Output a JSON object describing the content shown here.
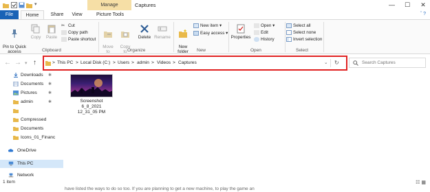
{
  "titlebar": {
    "manage_label": "Manage",
    "window_title": "Captures",
    "min": "—",
    "max": "☐",
    "close": "✕"
  },
  "tabs": {
    "file": "File",
    "home": "Home",
    "share": "Share",
    "view": "View",
    "picture_tools": "Picture Tools"
  },
  "ribbon": {
    "pin_to_quick_access": "Pin to Quick\naccess",
    "copy": "Copy",
    "paste": "Paste",
    "cut": "Cut",
    "copy_path": "Copy path",
    "paste_shortcut": "Paste shortcut",
    "move_to": "Move\nto",
    "copy_to": "Copy\nto",
    "delete": "Delete",
    "rename": "Rename",
    "new_folder": "New\nfolder",
    "new_item": "New item",
    "easy_access": "Easy access",
    "properties": "Properties",
    "open": "Open",
    "edit": "Edit",
    "history": "History",
    "select_all": "Select all",
    "select_none": "Select none",
    "invert_selection": "Invert selection",
    "group_clipboard": "Clipboard",
    "group_organize": "Organize",
    "group_new": "New",
    "group_open": "Open",
    "group_select": "Select"
  },
  "address": {
    "crumbs": [
      "This PC",
      "Local Disk (C:)",
      "Users",
      "admin",
      "Videos",
      "Captures"
    ],
    "separator": ">",
    "search_placeholder": "Search Captures"
  },
  "navpane": {
    "items": [
      {
        "label": "Downloads",
        "icon": "download-icon",
        "pinned": true
      },
      {
        "label": "Documents",
        "icon": "documents-icon",
        "pinned": true
      },
      {
        "label": "Pictures",
        "icon": "pictures-icon",
        "pinned": true
      },
      {
        "label": "admin",
        "icon": "folder-icon",
        "pinned": true
      },
      {
        "label": "Compressed",
        "icon": "folder-icon",
        "pinned": false
      },
      {
        "label": "Documents",
        "icon": "folder-icon",
        "pinned": false
      },
      {
        "label": "Icons_01_Financ",
        "icon": "folder-icon",
        "pinned": false
      },
      {
        "label": "OneDrive",
        "icon": "cloud-icon",
        "pinned": false
      },
      {
        "label": "This PC",
        "icon": "computer-icon",
        "pinned": false,
        "selected": true
      },
      {
        "label": "Network",
        "icon": "network-icon",
        "pinned": false
      }
    ]
  },
  "files": [
    {
      "name": "Screenshot\n6_8_2021\n12_31_05 PM"
    }
  ],
  "status": {
    "item_count": "1 item"
  },
  "background_text": "have listed the ways to do so too. If you are planning to get a new machine, to play the game an",
  "colors": {
    "accent": "#1a63b6",
    "manage_bg": "#f6dfa6",
    "highlight_box": "#e02020",
    "selected_bg": "#d4e7f9"
  }
}
